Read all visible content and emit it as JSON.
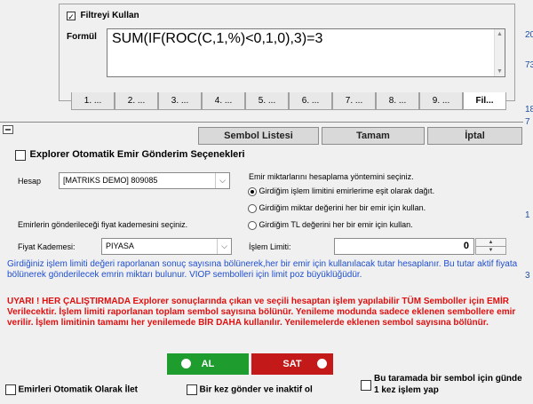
{
  "filter": {
    "use_filter_label": "Filtreyi Kullan",
    "use_filter_checked": "✓",
    "formula_label": "Formül",
    "formula_text": "SUM(IF(ROC(C,1,%)<0,1,0),3)=3",
    "tabs": [
      "1. ...",
      "2. ...",
      "3. ...",
      "4. ...",
      "5. ...",
      "6. ...",
      "7. ...",
      "8. ...",
      "9. ...",
      "Fil..."
    ],
    "active_tab": 9
  },
  "edge_numbers": [
    "20",
    "73",
    "18",
    "7",
    "1",
    "3"
  ],
  "top_buttons": {
    "symbol_list": "Sembol Listesi",
    "ok": "Tamam",
    "cancel": "İptal"
  },
  "explorer": {
    "title": "Explorer Otomatik Emir Gönderim Seçenekleri",
    "account_label": "Hesap",
    "account_value": "[MATRIKS DEMO] 809085",
    "method_prompt": "Emir miktarlarını hesaplama yöntemini seçiniz.",
    "methods": [
      "Girdiğim işlem limitini emirlerime eşit olarak dağıt.",
      "Girdiğim miktar değerini her bir emir için kullan.",
      "Girdiğim TL değerini her bir emir için kullan."
    ],
    "selected_method": 0,
    "price_prompt": "Emirlerin gönderileceği fiyat kademesini seçiniz.",
    "price_level_label": "Fiyat Kademesi:",
    "price_level_value": "PIYASA",
    "trade_limit_label": "İşlem Limiti:",
    "trade_limit_value": "0",
    "info_text": "Girdiğiniz işlem limiti değeri raporlanan sonuç sayısına bölünerek,her bir emir için kullanılacak tutar hesaplanır. Bu tutar aktif fiyata bölünerek gönderilecek emrin miktarı bulunur. VIOP sembolleri için limit poz büyüklüğüdür.",
    "warning_text": "UYARI ! HER ÇALIŞTIRMADA Explorer sonuçlarında çıkan ve seçili hesaptan işlem yapılabilir TÜM Semboller için EMİR Verilecektir. İşlem limiti raporlanan toplam sembol sayısına bölünür. Yenileme modunda sadece eklenen sembollere emir verilir. İşlem limitinin tamamı her yenilemede BİR DAHA kullanılır. Yenilemelerde eklenen sembol sayısına bölünür.",
    "buy_label": "AL",
    "sell_label": "SAT",
    "auto_send_label": "Emirleri Otomatik Olarak İlet",
    "send_once_label": "Bir kez gönder ve inaktif ol",
    "once_per_day_label": "Bu taramada bir sembol için günde 1 kez işlem yap"
  },
  "colors": {
    "buy": "#1e9c2e",
    "sell": "#c41919",
    "info": "#1f4fd0",
    "warning": "#e01010"
  }
}
